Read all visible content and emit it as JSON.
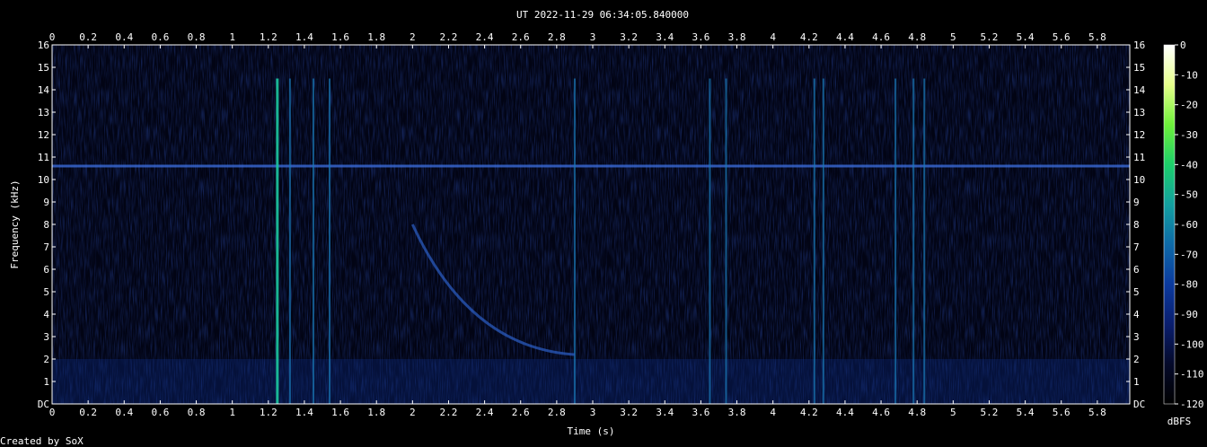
{
  "chart_data": {
    "type": "heatmap",
    "title": "UT 2022-11-29 06:34:05.840000",
    "xlabel": "Time (s)",
    "ylabel": "Frequency (kHz)",
    "xlim": [
      0,
      5.98
    ],
    "ylim": [
      0,
      16
    ],
    "x_ticks": [
      "0",
      "0.2",
      "0.4",
      "0.6",
      "0.8",
      "1",
      "1.2",
      "1.4",
      "1.6",
      "1.8",
      "2",
      "2.2",
      "2.4",
      "2.6",
      "2.8",
      "3",
      "3.2",
      "3.4",
      "3.6",
      "3.8",
      "4",
      "4.2",
      "4.4",
      "4.6",
      "4.8",
      "5",
      "5.2",
      "5.4",
      "5.6",
      "5.8"
    ],
    "y_ticks": [
      "DC",
      "1",
      "2",
      "3",
      "4",
      "5",
      "6",
      "7",
      "8",
      "9",
      "10",
      "11",
      "12",
      "13",
      "14",
      "15",
      "16"
    ],
    "colorbar": {
      "label": "dBFS",
      "range": [
        -120,
        0
      ],
      "ticks": [
        "0",
        "-10",
        "-20",
        "-30",
        "-40",
        "-50",
        "-60",
        "-70",
        "-80",
        "-90",
        "-100",
        "-110",
        "-120"
      ],
      "colors": [
        "#000000",
        "#050a2a",
        "#0a1e6e",
        "#0b3a9e",
        "#0e6aa8",
        "#13a0a0",
        "#1ccf6a",
        "#6ef03a",
        "#e6ff8a",
        "#ffffff"
      ]
    },
    "features": {
      "tone_khz": 10.6,
      "impulses_s": [
        1.25,
        1.32,
        1.45,
        1.54,
        2.9,
        3.65,
        3.74,
        4.23,
        4.28,
        4.68,
        4.78,
        4.84
      ],
      "sweep": {
        "t_start": 2.0,
        "f_start": 8.0,
        "t_end": 2.9,
        "f_end": 2.2
      }
    }
  },
  "footer": "Created by SoX"
}
